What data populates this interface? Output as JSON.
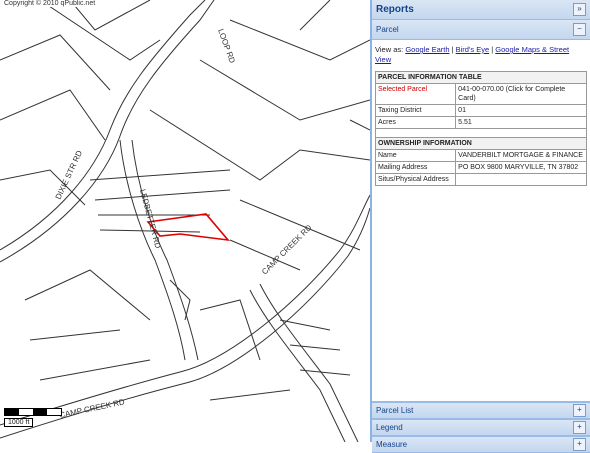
{
  "map": {
    "copyright": "Copyright © 2010 qPublic.net",
    "scale_label": "1000 ft",
    "roads": [
      "LEDBETTER RD",
      "DIXIE STR RD",
      "CAMP CREEK RD",
      "LOOP RD"
    ]
  },
  "panel": {
    "title": "Reports",
    "collapse_icon": "double-chevron-right-icon",
    "parcel_section": {
      "title": "Parcel",
      "views_label": "View as:",
      "links": [
        "Google Earth",
        "Bird's Eye",
        "Google Maps & Street View"
      ],
      "table_title": "PARCEL INFORMATION TABLE",
      "rows": [
        {
          "label": "Selected Parcel",
          "value": "041-00-070.00 (Click for Complete Card)"
        },
        {
          "label": "Taxing District",
          "value": "01"
        },
        {
          "label": "Acres",
          "value": "5.51"
        }
      ],
      "owner_title": "OWNERSHIP INFORMATION",
      "owner_rows": [
        {
          "label": "Name",
          "value": "VANDERBILT MORTGAGE & FINANCE"
        },
        {
          "label": "Mailing Address",
          "value": "PO BOX 9800 MARYVILLE, TN 37802"
        },
        {
          "label": "Situs/Physical Address",
          "value": ""
        }
      ]
    },
    "sections": [
      "Parcel List",
      "Legend",
      "Measure"
    ]
  }
}
